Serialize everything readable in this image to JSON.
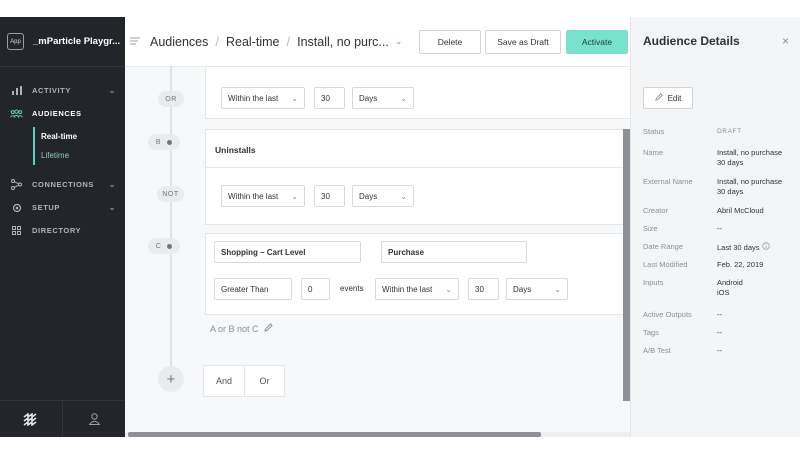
{
  "sidebar": {
    "app_badge": "App",
    "org_name": "_mParticle Playgr...",
    "nav": [
      {
        "label": "ACTIVITY",
        "icon": "bar-chart-icon",
        "has_chevron": true
      },
      {
        "label": "AUDIENCES",
        "icon": "people-icon",
        "has_chevron": false,
        "active": true
      },
      {
        "label": "CONNECTIONS",
        "icon": "connections-icon",
        "has_chevron": true
      },
      {
        "label": "SETUP",
        "icon": "gear-icon",
        "has_chevron": true
      },
      {
        "label": "DIRECTORY",
        "icon": "grid-icon",
        "has_chevron": false
      }
    ],
    "subnav": [
      {
        "label": "Real-time",
        "active": true
      },
      {
        "label": "Lifetime",
        "active": false
      }
    ]
  },
  "topbar": {
    "breadcrumbs": [
      "Audiences",
      "Real-time",
      "Install, no purc..."
    ],
    "delete_label": "Delete",
    "save_draft_label": "Save as Draft",
    "activate_label": "Activate"
  },
  "builder": {
    "or_tag": "OR",
    "or_within": "Within the last",
    "or_number": "30",
    "or_unit": "Days",
    "b_tag": "B",
    "b_title": "Uninstalls",
    "not_tag": "NOT",
    "not_within": "Within the last",
    "not_number": "30",
    "not_unit": "Days",
    "c_tag": "C",
    "c_category": "Shopping – Cart Level",
    "c_event": "Purchase",
    "c_operator": "Greater Than",
    "c_count": "0",
    "c_events_label": "events",
    "c_within": "Within the last",
    "c_number": "30",
    "c_unit": "Days",
    "expression": "A or B not C",
    "and_label": "And",
    "or_label": "Or",
    "add_symbol": "+"
  },
  "panel": {
    "title": "Audience Details",
    "close": "×",
    "edit_label": "Edit",
    "status_label": "Status",
    "status_value": "DRAFT",
    "name_label": "Name",
    "name_value_1": "Install, no purchase",
    "name_value_2": "30 days",
    "external_label": "External Name",
    "external_value_1": "Install, no purchase",
    "external_value_2": "30 days",
    "creator_label": "Creator",
    "creator_value": "Abril McCloud",
    "size_label": "Size",
    "size_value": "--",
    "date_range_label": "Date Range",
    "date_range_value": "Last 30 days",
    "modified_label": "Last Modified",
    "modified_value": "Feb. 22, 2019",
    "inputs_label": "Inputs",
    "inputs_value_1": "Android",
    "inputs_value_2": "iOS",
    "outputs_label": "Active Outputs",
    "outputs_value": "--",
    "tags_label": "Tags",
    "tags_value": "--",
    "ab_label": "A/B Test",
    "ab_value": "--"
  },
  "colors": {
    "accent": "#79e2cc",
    "sidebar_bg": "#22262b"
  }
}
